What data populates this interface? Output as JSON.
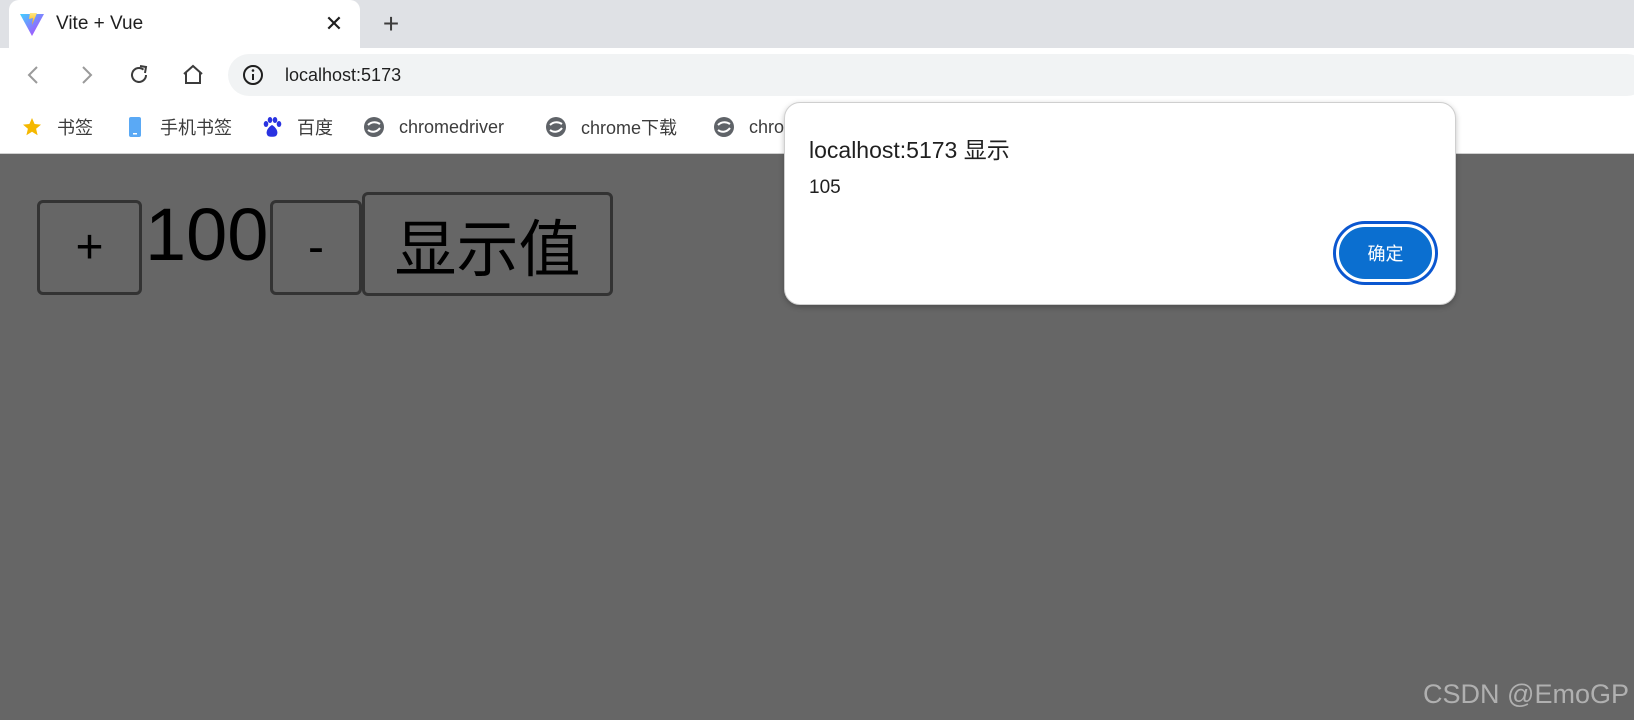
{
  "browser": {
    "tab": {
      "title": "Vite + Vue",
      "close_label": "✕"
    },
    "new_tab_label": "+",
    "address": {
      "url": "localhost:5173"
    },
    "bookmarks": [
      {
        "label": "书签",
        "icon": "star-icon"
      },
      {
        "label": "手机书签",
        "icon": "phone-icon"
      },
      {
        "label": "百度",
        "icon": "baidu-icon"
      },
      {
        "label": "chromedriver",
        "icon": "globe-icon"
      },
      {
        "label": "chrome下载",
        "icon": "globe-icon"
      },
      {
        "label": "chro",
        "icon": "globe-icon"
      }
    ]
  },
  "page": {
    "plus_label": "+",
    "counter_value": "100",
    "minus_label": "-",
    "show_value_label": "显示值",
    "watermark": "CSDN @EmoGP"
  },
  "dialog": {
    "title": "localhost:5173 显示",
    "message": "105",
    "ok_label": "确定"
  },
  "colors": {
    "page_background": "#666666",
    "button_border": "#333333",
    "dialog_ok_background": "#0b6fd0",
    "dialog_ok_ring": "#0b57d0"
  }
}
